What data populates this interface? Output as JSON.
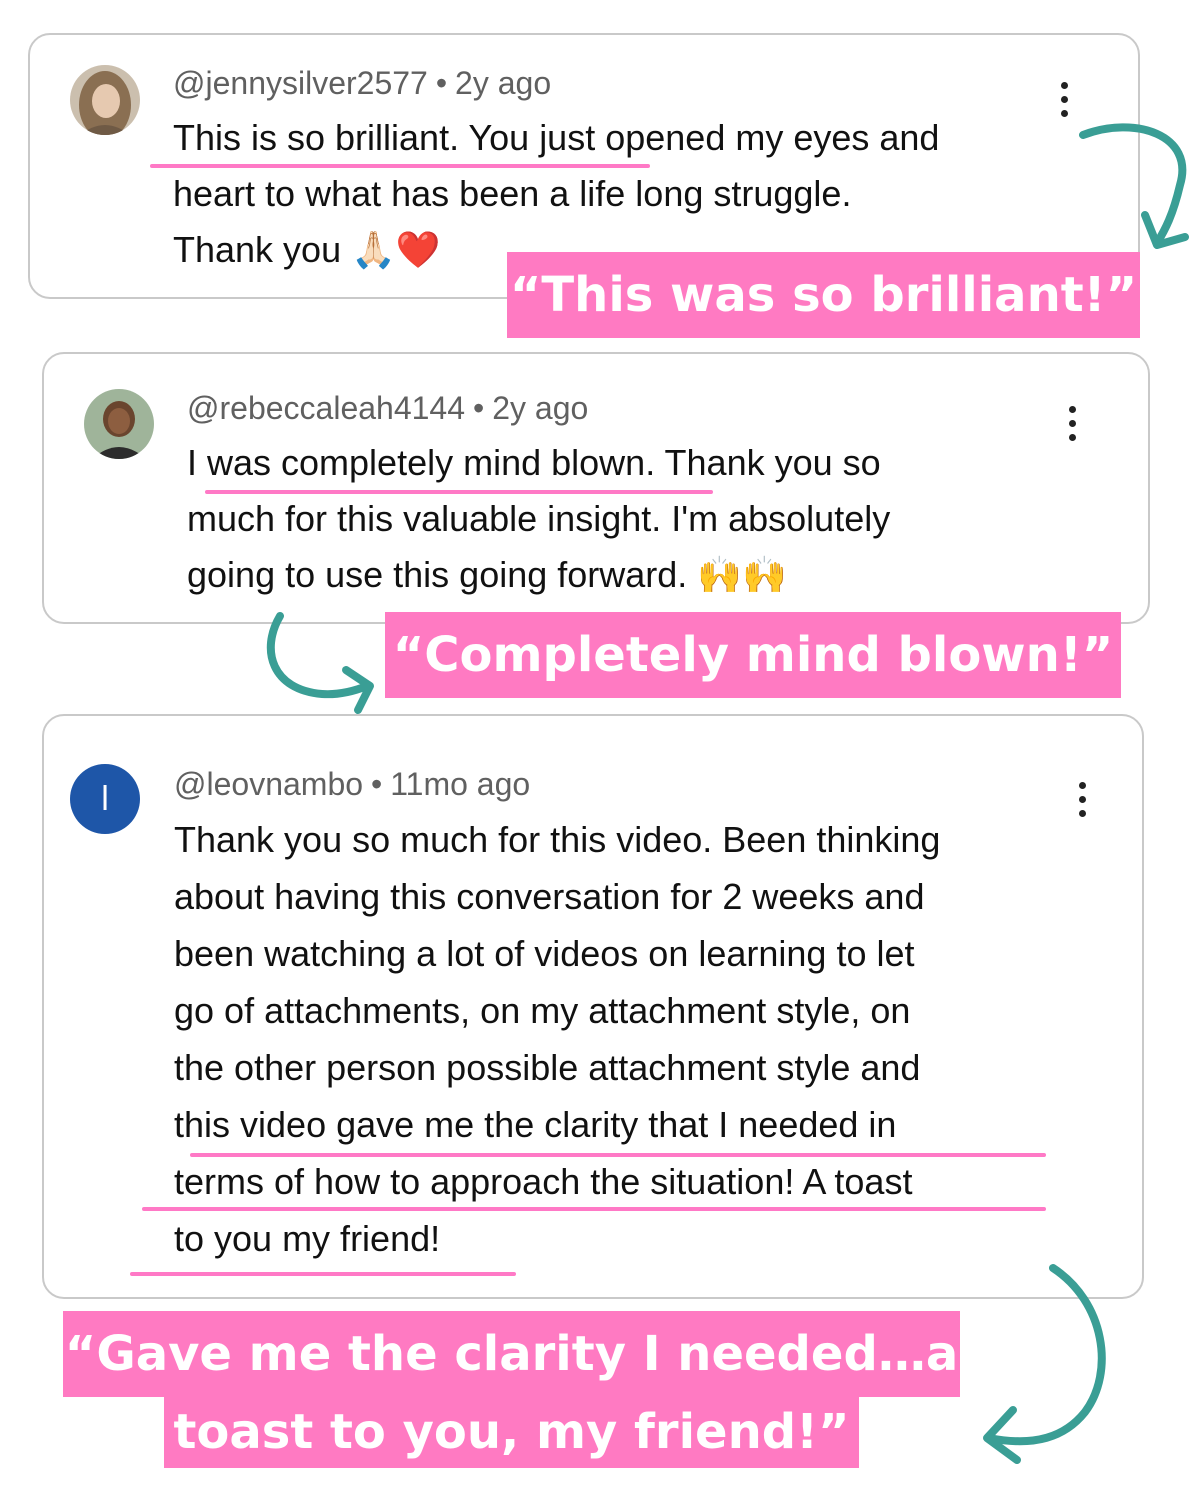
{
  "comments": [
    {
      "username": "@jennysilver2577",
      "separator": "•",
      "time": "2y ago",
      "lines": [
        "This is so brilliant. You just opened my eyes and",
        "heart to what has been a life long struggle.",
        "Thank you 🙏🏻❤️"
      ],
      "highlight_quote": "“This was so brilliant!”"
    },
    {
      "username": "@rebeccaleah4144",
      "separator": "•",
      "time": "2y ago",
      "lines": [
        "I was completely mind blown. Thank you so",
        "much for this valuable insight. I'm absolutely",
        "going to use this going forward. 🙌🙌"
      ],
      "highlight_quote": "“Completely mind blown!”"
    },
    {
      "username": "@leovnambo",
      "separator": "•",
      "time": "11mo ago",
      "avatar_letter": "l",
      "lines": [
        "Thank you so much for this video. Been thinking",
        "about having this conversation for 2 weeks and",
        "been watching a lot of videos on learning to let",
        "go of attachments, on my attachment style, on",
        "the other person possible attachment style and",
        "this video gave me the clarity that I needed in",
        "terms of how to approach the situation! A toast",
        "to you my friend!"
      ],
      "highlight_quote_lines": [
        "“Gave me the clarity I needed…a",
        "toast  to you, my friend!”"
      ]
    }
  ],
  "colors": {
    "accent_pink": "#ff7ac2",
    "underline_pink": "#ff79c6",
    "arrow_teal": "#3a9e95",
    "avatar_blue": "#1e56a8"
  },
  "icons": [
    "more-vert-icon",
    "curved-arrow-icon"
  ]
}
